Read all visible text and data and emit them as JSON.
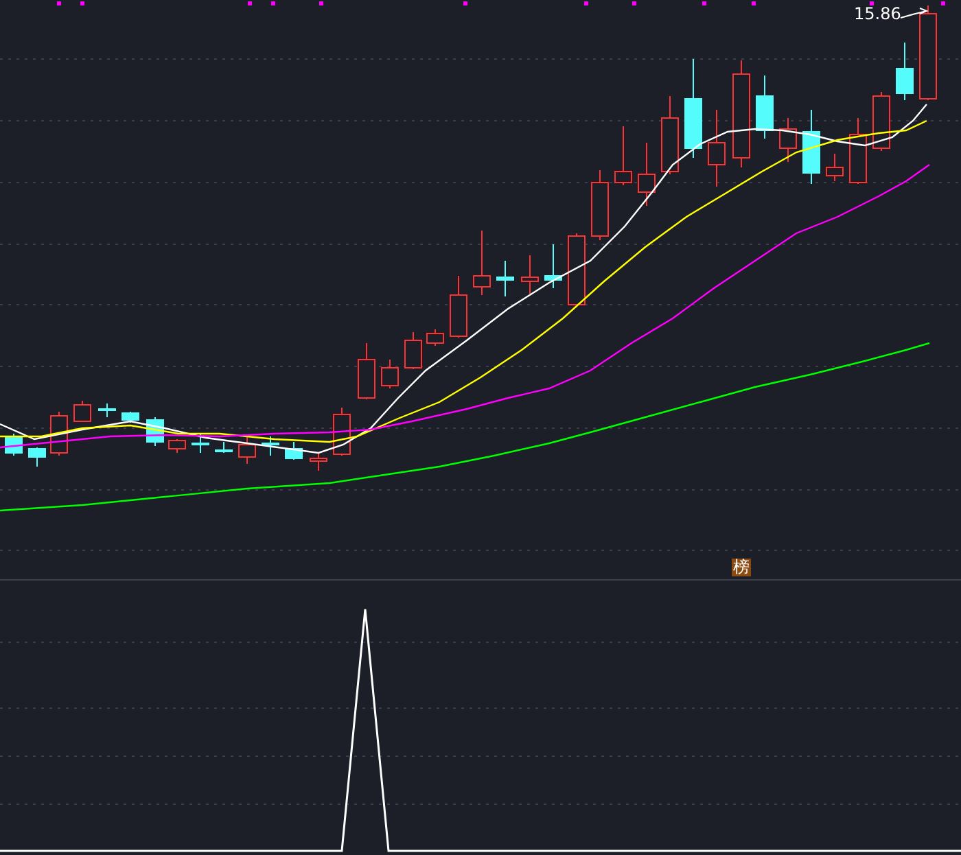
{
  "price_chart": {
    "high_label": "15.86",
    "signal_label": "榜"
  }
}
